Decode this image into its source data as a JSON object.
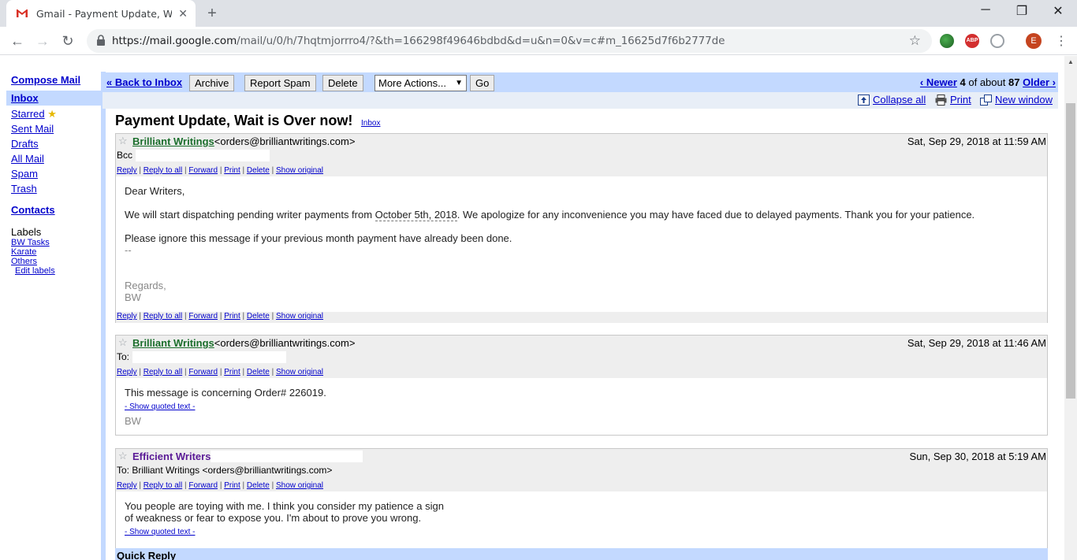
{
  "browser": {
    "tab_title": "Gmail - Payment Update, Wait is",
    "url_host": "https://mail.google.com",
    "url_path": "/mail/u/0/h/7hqtmjorrro4/?&th=166298f49646bdbd&d=u&n=0&v=c#m_16625d7f6b2777de",
    "profile_initial": "E"
  },
  "sidebar": {
    "compose": "Compose Mail",
    "items": [
      "Inbox",
      "Starred",
      "Sent Mail",
      "Drafts",
      "All Mail",
      "Spam",
      "Trash"
    ],
    "contacts": "Contacts",
    "labels_heading": "Labels",
    "labels": [
      "BW Tasks",
      "Karate",
      "Others"
    ],
    "edit_labels": "Edit labels"
  },
  "topbar": {
    "back": "« Back to Inbox",
    "archive": "Archive",
    "report_spam": "Report Spam",
    "delete": "Delete",
    "more_actions": "More Actions...",
    "go": "Go",
    "newer": "‹ Newer",
    "position": "4",
    "of_about": "of about",
    "total": "87",
    "older": "Older ›"
  },
  "subbar": {
    "collapse_all": "Collapse all",
    "print": "Print",
    "new_window": "New window"
  },
  "thread": {
    "subject": "Payment Update, Wait is Over now!",
    "label": "Inbox"
  },
  "actions": {
    "reply": "Reply",
    "reply_all": "Reply to all",
    "forward": "Forward",
    "print": "Print",
    "delete": "Delete",
    "show_original": "Show original"
  },
  "messages": [
    {
      "sender": "Brilliant Writings",
      "email": "<orders@brilliantwritings.com>",
      "date": "Sat, Sep 29, 2018 at 11:59 AM",
      "recipient_label": "Bcc",
      "greeting": "Dear Writers,",
      "line1_a": "We will start dispatching pending writer payments from ",
      "line1_date": "October 5th, 2018",
      "line1_b": ". We apologize for any inconvenience you may have faced due to delayed payments. Thank you for your patience.",
      "line2": "Please ignore this message if your previous month payment have already been done.",
      "dashes": "--",
      "regards": "Regards,",
      "signature": "BW"
    },
    {
      "sender": "Brilliant Writings",
      "email": "<orders@brilliantwritings.com>",
      "date": "Sat, Sep 29, 2018 at 11:46 AM",
      "recipient_label": "To:",
      "text": "This message is concerning Order# 226019.",
      "quoted": "- Show quoted text -",
      "signature": "BW"
    },
    {
      "sender": "Efficient Writers",
      "date": "Sun, Sep 30, 2018 at 5:19 AM",
      "recipient_label": "To: Brilliant Writings <orders@brilliantwritings.com>",
      "text1": "You people are toying with me. I think you consider my patience a sign",
      "text2": "of weakness or fear to expose you. I'm about to prove you wrong.",
      "quoted": "- Show quoted text -"
    }
  ],
  "quick_reply": "Quick Reply",
  "colors": {
    "gmail_blue": "#c3d9ff",
    "link": "#0000cc",
    "sender_green": "#1a6e2b",
    "sender_purple": "#5a1a96"
  }
}
